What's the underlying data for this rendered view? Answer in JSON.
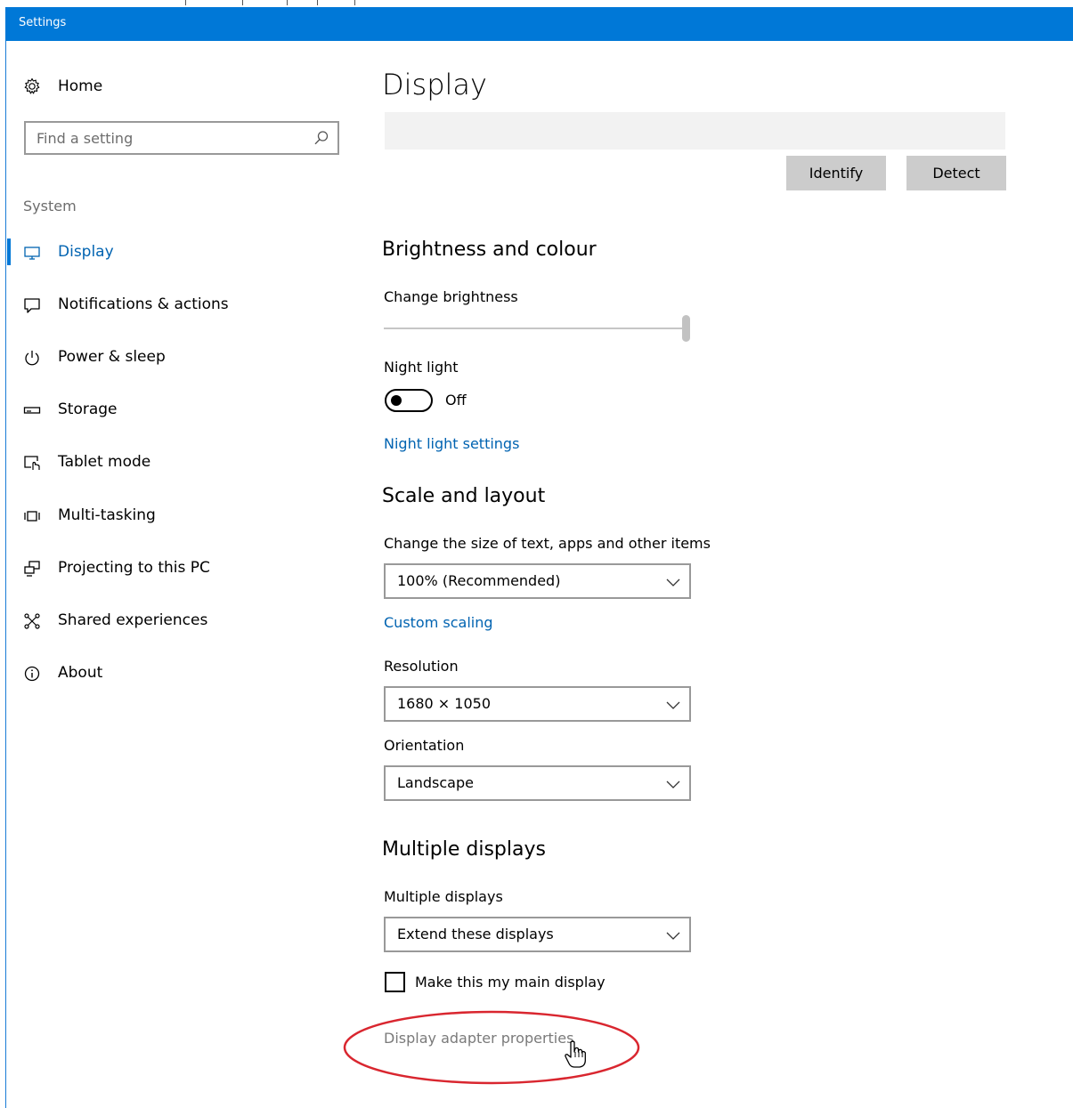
{
  "window": {
    "title": "Settings"
  },
  "sidebar": {
    "home": "Home",
    "search_placeholder": "Find a setting",
    "section": "System",
    "items": [
      {
        "label": "Display",
        "icon": "monitor-icon",
        "active": true
      },
      {
        "label": "Notifications & actions",
        "icon": "speech-bubble-icon"
      },
      {
        "label": "Power & sleep",
        "icon": "power-icon"
      },
      {
        "label": "Storage",
        "icon": "storage-drive-icon"
      },
      {
        "label": "Tablet mode",
        "icon": "tablet-mode-icon"
      },
      {
        "label": "Multi-tasking",
        "icon": "multitasking-icon"
      },
      {
        "label": "Projecting to this PC",
        "icon": "projecting-icon"
      },
      {
        "label": "Shared experiences",
        "icon": "shared-experiences-icon"
      },
      {
        "label": "About",
        "icon": "info-icon"
      }
    ]
  },
  "main": {
    "title": "Display",
    "identify": "Identify",
    "detect": "Detect",
    "brightness": {
      "heading": "Brightness and colour",
      "label": "Change brightness",
      "level": 1.0,
      "night_light_label": "Night light",
      "night_light_state": "Off",
      "night_light_link": "Night light settings"
    },
    "scale": {
      "heading": "Scale and layout",
      "size_label": "Change the size of text, apps and other items",
      "size_value": "100% (Recommended)",
      "custom_link": "Custom scaling",
      "resolution_label": "Resolution",
      "resolution_value": "1680 × 1050",
      "orientation_label": "Orientation",
      "orientation_value": "Landscape"
    },
    "multiple": {
      "heading": "Multiple displays",
      "label": "Multiple displays",
      "value": "Extend these displays",
      "main_display_label": "Make this my main display",
      "main_display_checked": false,
      "adapter_link": "Display adapter properties"
    }
  },
  "colors": {
    "accent": "#0078d7",
    "link": "#0063b1",
    "annotation": "#d9262f"
  }
}
